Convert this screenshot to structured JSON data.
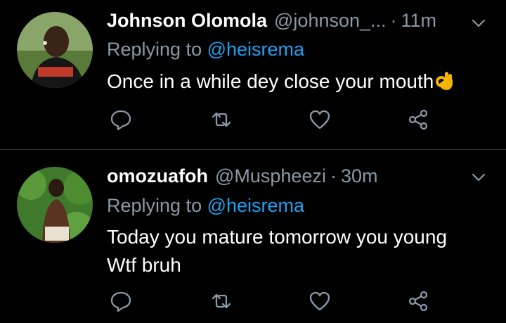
{
  "tweets": [
    {
      "display_name": "Johnson Olomola",
      "handle": "@johnson_...",
      "separator": "·",
      "time": "11m",
      "replying_prefix": "Replying to",
      "replying_to": "@heisrema",
      "text": "Once in a while dey close your mouth",
      "emoji": "ok-hand-emoji"
    },
    {
      "display_name": "omozuafoh",
      "handle": "@Muspheezi",
      "separator": "·",
      "time": "30m",
      "replying_prefix": "Replying to",
      "replying_to": "@heisrema",
      "text_line1": "Today you mature tomorrow you young",
      "text_line2": "Wtf bruh"
    }
  ],
  "icons": [
    "reply-icon",
    "retweet-icon",
    "like-icon",
    "share-icon",
    "chevron-down-icon"
  ],
  "colors": {
    "background": "#000000",
    "primary_text": "#ffffff",
    "secondary_text": "#8b98a5",
    "mention": "#1da1f2",
    "divider": "#2f3336"
  }
}
